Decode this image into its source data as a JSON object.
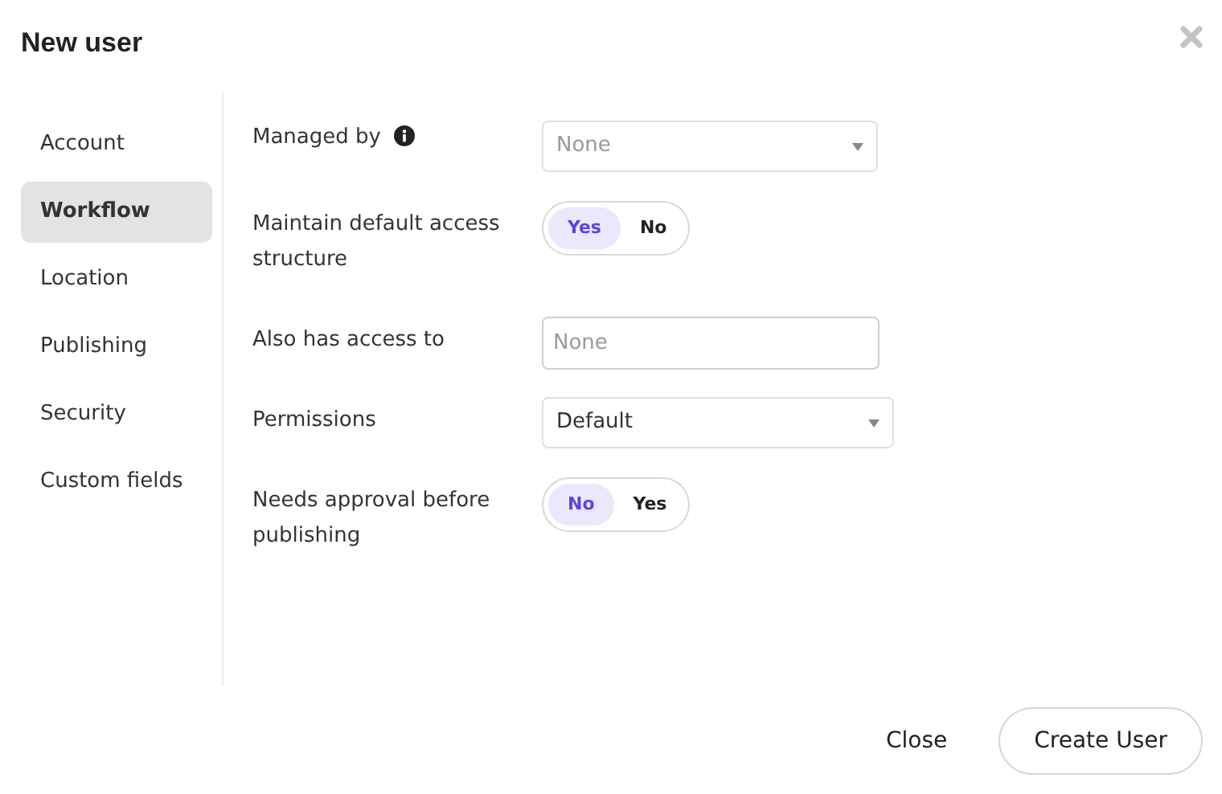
{
  "window": {
    "title": "New user"
  },
  "sidebar": {
    "items": [
      {
        "label": "Account",
        "selected": false
      },
      {
        "label": "Workflow",
        "selected": true
      },
      {
        "label": "Location",
        "selected": false
      },
      {
        "label": "Publishing",
        "selected": false
      },
      {
        "label": "Security",
        "selected": false
      },
      {
        "label": "Custom fields",
        "selected": false
      }
    ]
  },
  "fields": [
    {
      "kind": "select",
      "label": "Managed by",
      "info": true,
      "placeholder": "None",
      "wide": false
    },
    {
      "kind": "toggle",
      "label": "Maintain default access structure",
      "options": [
        {
          "label": "Yes",
          "selected": true
        },
        {
          "label": "No",
          "selected": false
        }
      ]
    },
    {
      "kind": "input",
      "label": "Also has access to",
      "placeholder": "None"
    },
    {
      "kind": "select",
      "label": "Permissions",
      "value": "Default",
      "wide": true
    },
    {
      "kind": "toggle",
      "label": "Needs approval before publishing",
      "options": [
        {
          "label": "No",
          "selected": true
        },
        {
          "label": "Yes",
          "selected": false
        }
      ]
    }
  ],
  "buttons": [
    {
      "kind": "link",
      "label": "Close"
    },
    {
      "kind": "outline",
      "label": "Create User"
    }
  ]
}
